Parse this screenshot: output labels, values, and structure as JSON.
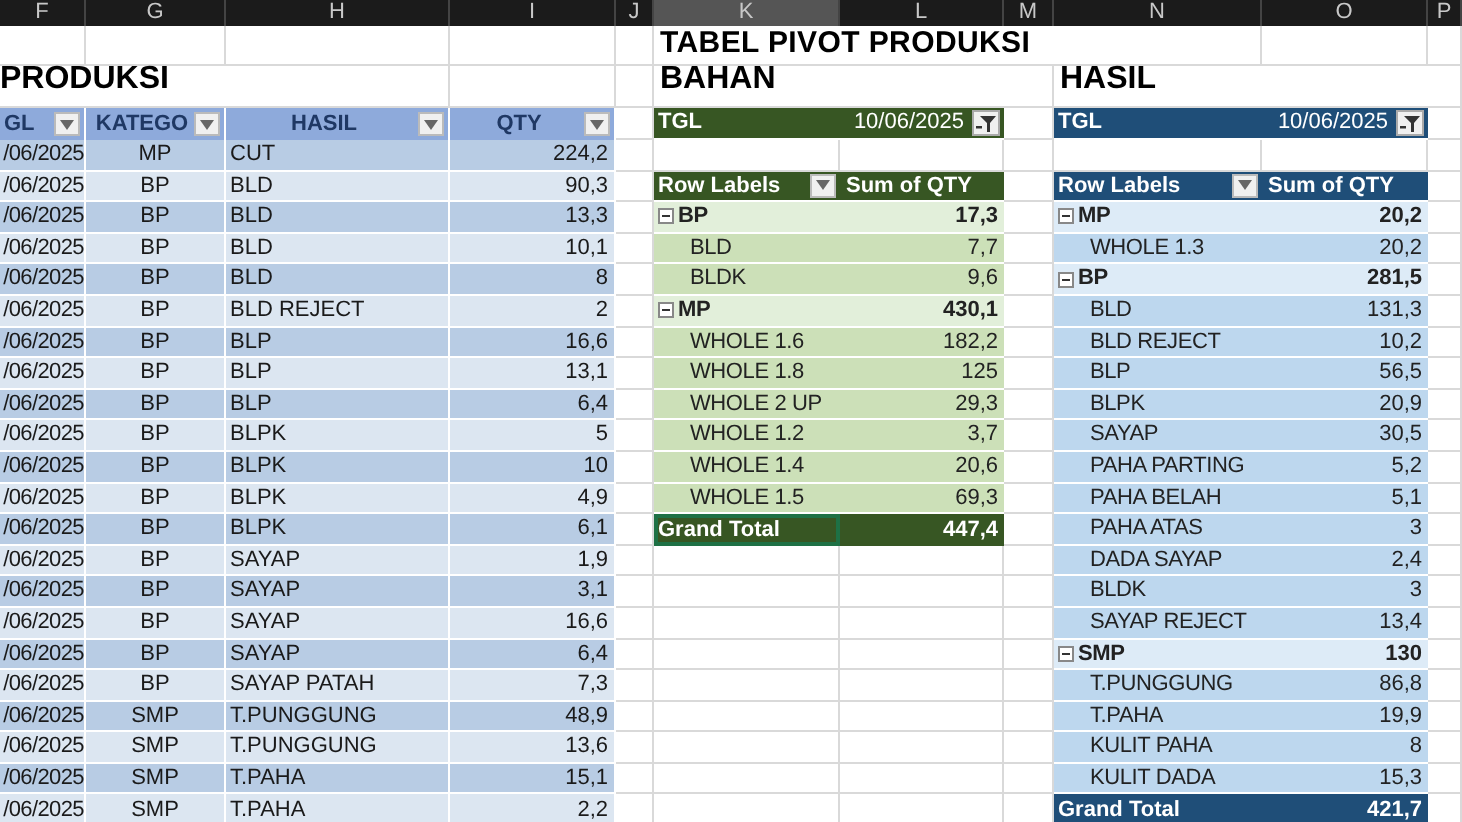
{
  "column_headers": [
    {
      "label": "F",
      "selected": false
    },
    {
      "label": "G",
      "selected": false
    },
    {
      "label": "H",
      "selected": false
    },
    {
      "label": "I",
      "selected": false
    },
    {
      "label": "J",
      "selected": false
    },
    {
      "label": "K",
      "selected": true
    },
    {
      "label": "L",
      "selected": false
    },
    {
      "label": "M",
      "selected": false
    },
    {
      "label": "N",
      "selected": false
    },
    {
      "label": "O",
      "selected": false
    },
    {
      "label": "P",
      "selected": false
    }
  ],
  "title": "TABEL PIVOT PRODUKSI",
  "produksi": {
    "title": "PRODUKSI",
    "columns": [
      "GL",
      "KATEGO",
      "HASIL",
      "QTY"
    ],
    "rows": [
      {
        "tgl": "/06/2025",
        "kategori": "MP",
        "hasil": "CUT",
        "qty": "224,2"
      },
      {
        "tgl": "/06/2025",
        "kategori": "BP",
        "hasil": "BLD",
        "qty": "90,3"
      },
      {
        "tgl": "/06/2025",
        "kategori": "BP",
        "hasil": "BLD",
        "qty": "13,3"
      },
      {
        "tgl": "/06/2025",
        "kategori": "BP",
        "hasil": "BLD",
        "qty": "10,1"
      },
      {
        "tgl": "/06/2025",
        "kategori": "BP",
        "hasil": "BLD",
        "qty": "8"
      },
      {
        "tgl": "/06/2025",
        "kategori": "BP",
        "hasil": "BLD REJECT",
        "qty": "2"
      },
      {
        "tgl": "/06/2025",
        "kategori": "BP",
        "hasil": "BLP",
        "qty": "16,6"
      },
      {
        "tgl": "/06/2025",
        "kategori": "BP",
        "hasil": "BLP",
        "qty": "13,1"
      },
      {
        "tgl": "/06/2025",
        "kategori": "BP",
        "hasil": "BLP",
        "qty": "6,4"
      },
      {
        "tgl": "/06/2025",
        "kategori": "BP",
        "hasil": "BLPK",
        "qty": "5"
      },
      {
        "tgl": "/06/2025",
        "kategori": "BP",
        "hasil": "BLPK",
        "qty": "10"
      },
      {
        "tgl": "/06/2025",
        "kategori": "BP",
        "hasil": "BLPK",
        "qty": "4,9"
      },
      {
        "tgl": "/06/2025",
        "kategori": "BP",
        "hasil": "BLPK",
        "qty": "6,1"
      },
      {
        "tgl": "/06/2025",
        "kategori": "BP",
        "hasil": "SAYAP",
        "qty": "1,9"
      },
      {
        "tgl": "/06/2025",
        "kategori": "BP",
        "hasil": "SAYAP",
        "qty": "3,1"
      },
      {
        "tgl": "/06/2025",
        "kategori": "BP",
        "hasil": "SAYAP",
        "qty": "16,6"
      },
      {
        "tgl": "/06/2025",
        "kategori": "BP",
        "hasil": "SAYAP",
        "qty": "6,4"
      },
      {
        "tgl": "/06/2025",
        "kategori": "BP",
        "hasil": "SAYAP PATAH",
        "qty": "7,3"
      },
      {
        "tgl": "/06/2025",
        "kategori": "SMP",
        "hasil": "T.PUNGGUNG",
        "qty": "48,9"
      },
      {
        "tgl": "/06/2025",
        "kategori": "SMP",
        "hasil": "T.PUNGGUNG",
        "qty": "13,6"
      },
      {
        "tgl": "/06/2025",
        "kategori": "SMP",
        "hasil": "T.PAHA",
        "qty": "15,1"
      },
      {
        "tgl": "/06/2025",
        "kategori": "SMP",
        "hasil": "T.PAHA",
        "qty": "2,2"
      }
    ]
  },
  "bahan": {
    "title": "BAHAN",
    "filter": {
      "label": "TGL",
      "value": "10/06/2025"
    },
    "header": [
      "Row Labels",
      "Sum of QTY"
    ],
    "groups": [
      {
        "label": "BP",
        "value": "17,3",
        "expanded": true,
        "children": [
          {
            "label": "BLD",
            "value": "7,7"
          },
          {
            "label": "BLDK",
            "value": "9,6"
          }
        ]
      },
      {
        "label": "MP",
        "value": "430,1",
        "expanded": true,
        "children": [
          {
            "label": "WHOLE 1.6",
            "value": "182,2"
          },
          {
            "label": "WHOLE 1.8",
            "value": "125"
          },
          {
            "label": "WHOLE 2 UP",
            "value": "29,3"
          },
          {
            "label": "WHOLE 1.2",
            "value": "3,7"
          },
          {
            "label": "WHOLE 1.4",
            "value": "20,6"
          },
          {
            "label": "WHOLE 1.5",
            "value": "69,3"
          }
        ]
      }
    ],
    "grand_total": {
      "label": "Grand Total",
      "value": "447,4",
      "selected": true
    }
  },
  "hasil": {
    "title": "HASIL",
    "filter": {
      "label": "TGL",
      "value": "10/06/2025"
    },
    "header": [
      "Row Labels",
      "Sum of QTY"
    ],
    "groups": [
      {
        "label": "MP",
        "value": "20,2",
        "expanded": true,
        "children": [
          {
            "label": "WHOLE 1.3",
            "value": "20,2"
          }
        ]
      },
      {
        "label": "BP",
        "value": "281,5",
        "expanded": true,
        "children": [
          {
            "label": "BLD",
            "value": "131,3"
          },
          {
            "label": "BLD REJECT",
            "value": "10,2"
          },
          {
            "label": "BLP",
            "value": "56,5"
          },
          {
            "label": "BLPK",
            "value": "20,9"
          },
          {
            "label": "SAYAP",
            "value": "30,5"
          },
          {
            "label": "PAHA PARTING",
            "value": "5,2"
          },
          {
            "label": "PAHA BELAH",
            "value": "5,1"
          },
          {
            "label": "PAHA ATAS",
            "value": "3"
          },
          {
            "label": "DADA SAYAP",
            "value": "2,4"
          },
          {
            "label": "BLDK",
            "value": "3"
          },
          {
            "label": "SAYAP REJECT",
            "value": "13,4"
          }
        ]
      },
      {
        "label": "SMP",
        "value": "130",
        "expanded": true,
        "children": [
          {
            "label": "T.PUNGGUNG",
            "value": "86,8"
          },
          {
            "label": "T.PAHA",
            "value": "19,9"
          },
          {
            "label": "KULIT PAHA",
            "value": "8"
          },
          {
            "label": "KULIT DADA",
            "value": "15,3"
          }
        ]
      }
    ],
    "grand_total": {
      "label": "Grand Total",
      "value": "421,7",
      "selected": false
    }
  }
}
